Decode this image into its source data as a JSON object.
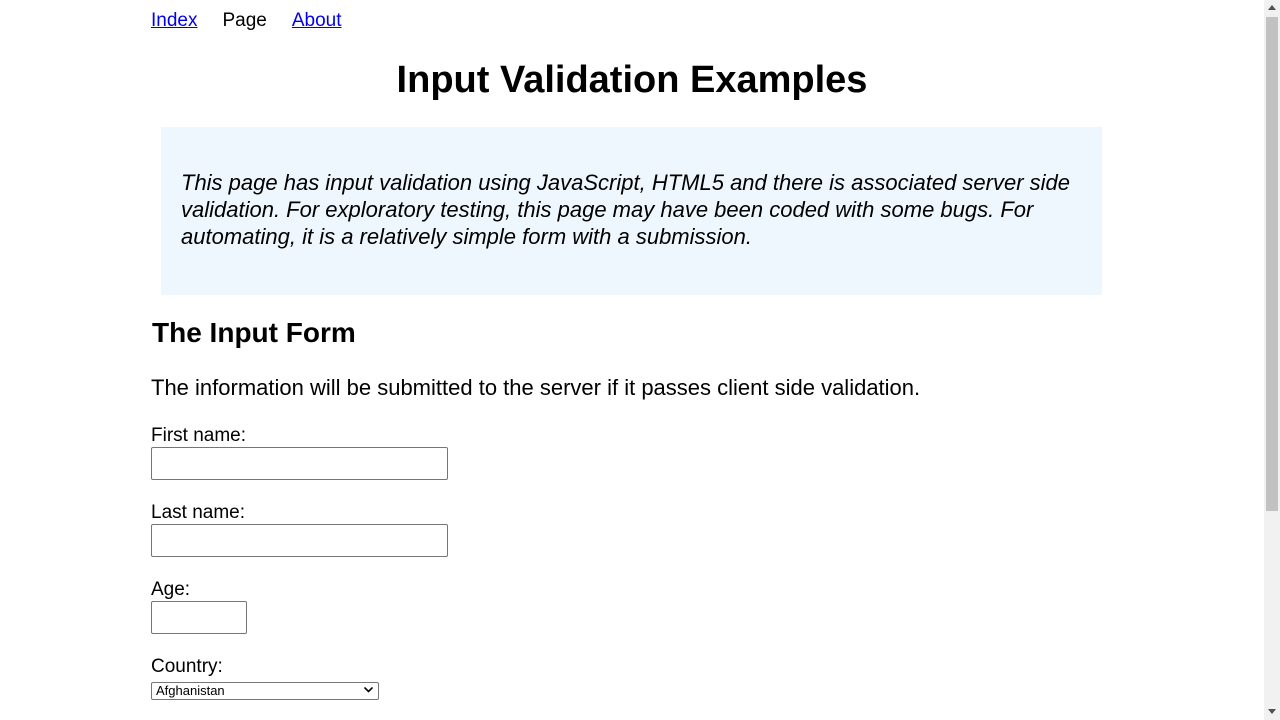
{
  "nav": {
    "items": [
      {
        "label": "Index",
        "link": true
      },
      {
        "label": "Page",
        "link": false
      },
      {
        "label": "About",
        "link": true
      }
    ]
  },
  "page_title": "Input Validation Examples",
  "intro_text": "This page has input validation using JavaScript, HTML5 and there is associated server side validation. For exploratory testing, this page may have been coded with some bugs. For automating, it is a relatively simple form with a submission.",
  "form": {
    "title": "The Input Form",
    "description": "The information will be submitted to the server if it passes client side validation.",
    "first_name": {
      "label": "First name:",
      "value": ""
    },
    "last_name": {
      "label": "Last name:",
      "value": ""
    },
    "age": {
      "label": "Age:",
      "value": ""
    },
    "country": {
      "label": "Country:",
      "selected": "Afghanistan"
    }
  },
  "icons": {
    "select_chevron": "chevron-down-icon",
    "scroll_up": "arrow-up-icon",
    "scroll_down": "arrow-down-icon"
  },
  "colors": {
    "link": "#0000ee",
    "intro_background": "#eff7fe"
  }
}
